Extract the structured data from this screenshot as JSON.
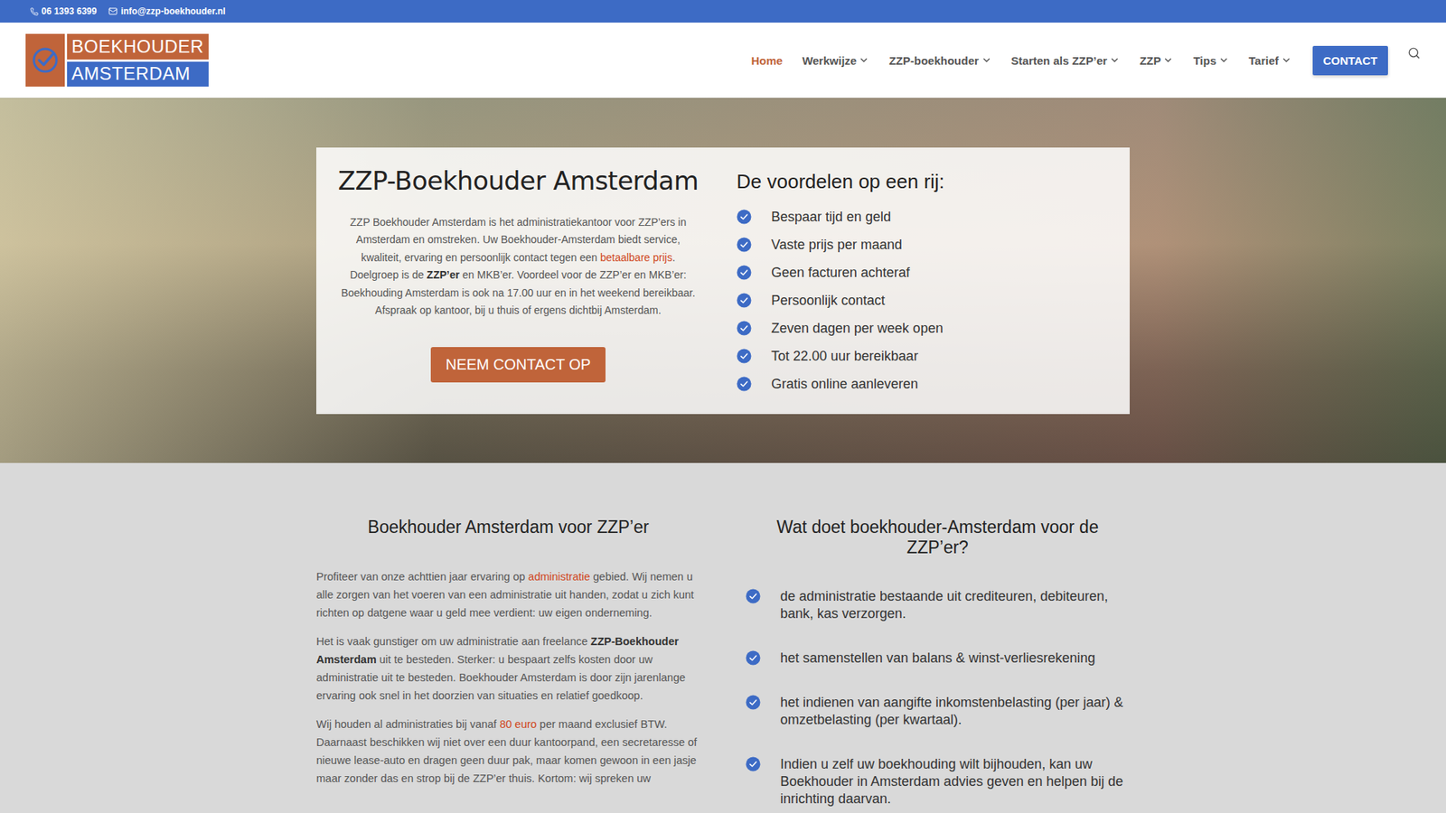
{
  "topbar": {
    "phone": "06 1393 6399",
    "email": "info@zzp-boekhouder.nl"
  },
  "logo": {
    "top": "BOEKHOUDER",
    "bottom": "AMSTERDAM"
  },
  "nav": [
    {
      "label": "Home",
      "selected": true,
      "dropdown": false
    },
    {
      "label": "Werkwijze",
      "selected": false,
      "dropdown": true
    },
    {
      "label": "ZZP-boekhouder",
      "selected": false,
      "dropdown": true
    },
    {
      "label": "Starten als ZZP’er",
      "selected": false,
      "dropdown": true
    },
    {
      "label": "ZZP",
      "selected": false,
      "dropdown": true
    },
    {
      "label": "Tips",
      "selected": false,
      "dropdown": true
    },
    {
      "label": "Tarief",
      "selected": false,
      "dropdown": true
    }
  ],
  "contact_button": "CONTACT",
  "hero": {
    "title": "ZZP-Boekhouder Amsterdam",
    "paragraph": [
      {
        "text": "ZZP Boekhouder Amsterdam is het administratiekantoor voor ZZP’ers in Amsterdam en omstreken. Uw Boekhouder-Amsterdam biedt service, kwaliteit, ervaring en persoonlijk contact tegen een ",
        "kind": "plain"
      },
      {
        "text": "betaalbare prijs",
        "kind": "link"
      },
      {
        "text": ". Doelgroep is de ",
        "kind": "plain"
      },
      {
        "text": "ZZP’er",
        "kind": "bold"
      },
      {
        "text": " en MKB’er.  Voordeel voor de ZZP’er en MKB’er: Boekhouding Amsterdam is ook na 17.00 uur en in het weekend bereikbaar. Afspraak op kantoor, bij u thuis of ergens dichtbij Amsterdam.",
        "kind": "plain"
      }
    ],
    "button": "NEEM CONTACT OP",
    "benefits_title": "De voordelen op een rij:",
    "benefits": [
      "Bespaar tijd en geld",
      "Vaste prijs per maand",
      "Geen facturen achteraf",
      "Persoonlijk contact",
      "Zeven dagen per week open",
      "Tot 22.00 uur bereikbaar",
      "Gratis online aanleveren"
    ]
  },
  "section": {
    "left": {
      "title": "Boekhouder Amsterdam voor ZZP’er",
      "paragraphs": [
        [
          {
            "text": "Profiteer van onze achttien jaar ervaring op ",
            "kind": "plain"
          },
          {
            "text": "administratie",
            "kind": "link"
          },
          {
            "text": " gebied. Wij nemen u alle zorgen van het voeren van een administratie uit handen, zodat u zich kunt richten op datgene waar u geld mee verdient: uw eigen onderneming.",
            "kind": "plain"
          }
        ],
        [
          {
            "text": "Het is vaak gunstiger om uw administratie aan freelance ",
            "kind": "plain"
          },
          {
            "text": "ZZP-Boekhouder Amsterdam",
            "kind": "bold"
          },
          {
            "text": " uit te besteden. Sterker: u bespaart zelfs kosten door uw administratie uit te besteden. Boekhouder Amsterdam is door zijn jarenlange ervaring ook snel in het doorzien van situaties en relatief goedkoop.",
            "kind": "plain"
          }
        ],
        [
          {
            "text": "Wij houden al administraties bij vanaf ",
            "kind": "plain"
          },
          {
            "text": "80 euro",
            "kind": "link"
          },
          {
            "text": " per maand exclusief BTW. Daarnaast beschikken wij niet over een duur kantoorpand, een secretaresse of nieuwe lease-auto en dragen geen duur pak, maar komen gewoon in een jasje maar zonder das en strop bij de ZZP’er thuis. Kortom: wij spreken uw",
            "kind": "plain"
          }
        ]
      ]
    },
    "right": {
      "title": "Wat doet boekhouder-Amsterdam voor de ZZP’er?",
      "items": [
        "de administratie bestaande uit crediteuren, debiteuren, bank, kas verzorgen.",
        "het samenstellen van balans & winst-verliesrekening",
        "het indienen van aangifte inkomstenbelasting (per jaar) & omzetbelasting (per kwartaal).",
        "Indien u zelf uw boekhouding wilt bijhouden, kan uw Boekhouder in Amsterdam advies geven en helpen bij de inrichting daarvan."
      ]
    }
  }
}
